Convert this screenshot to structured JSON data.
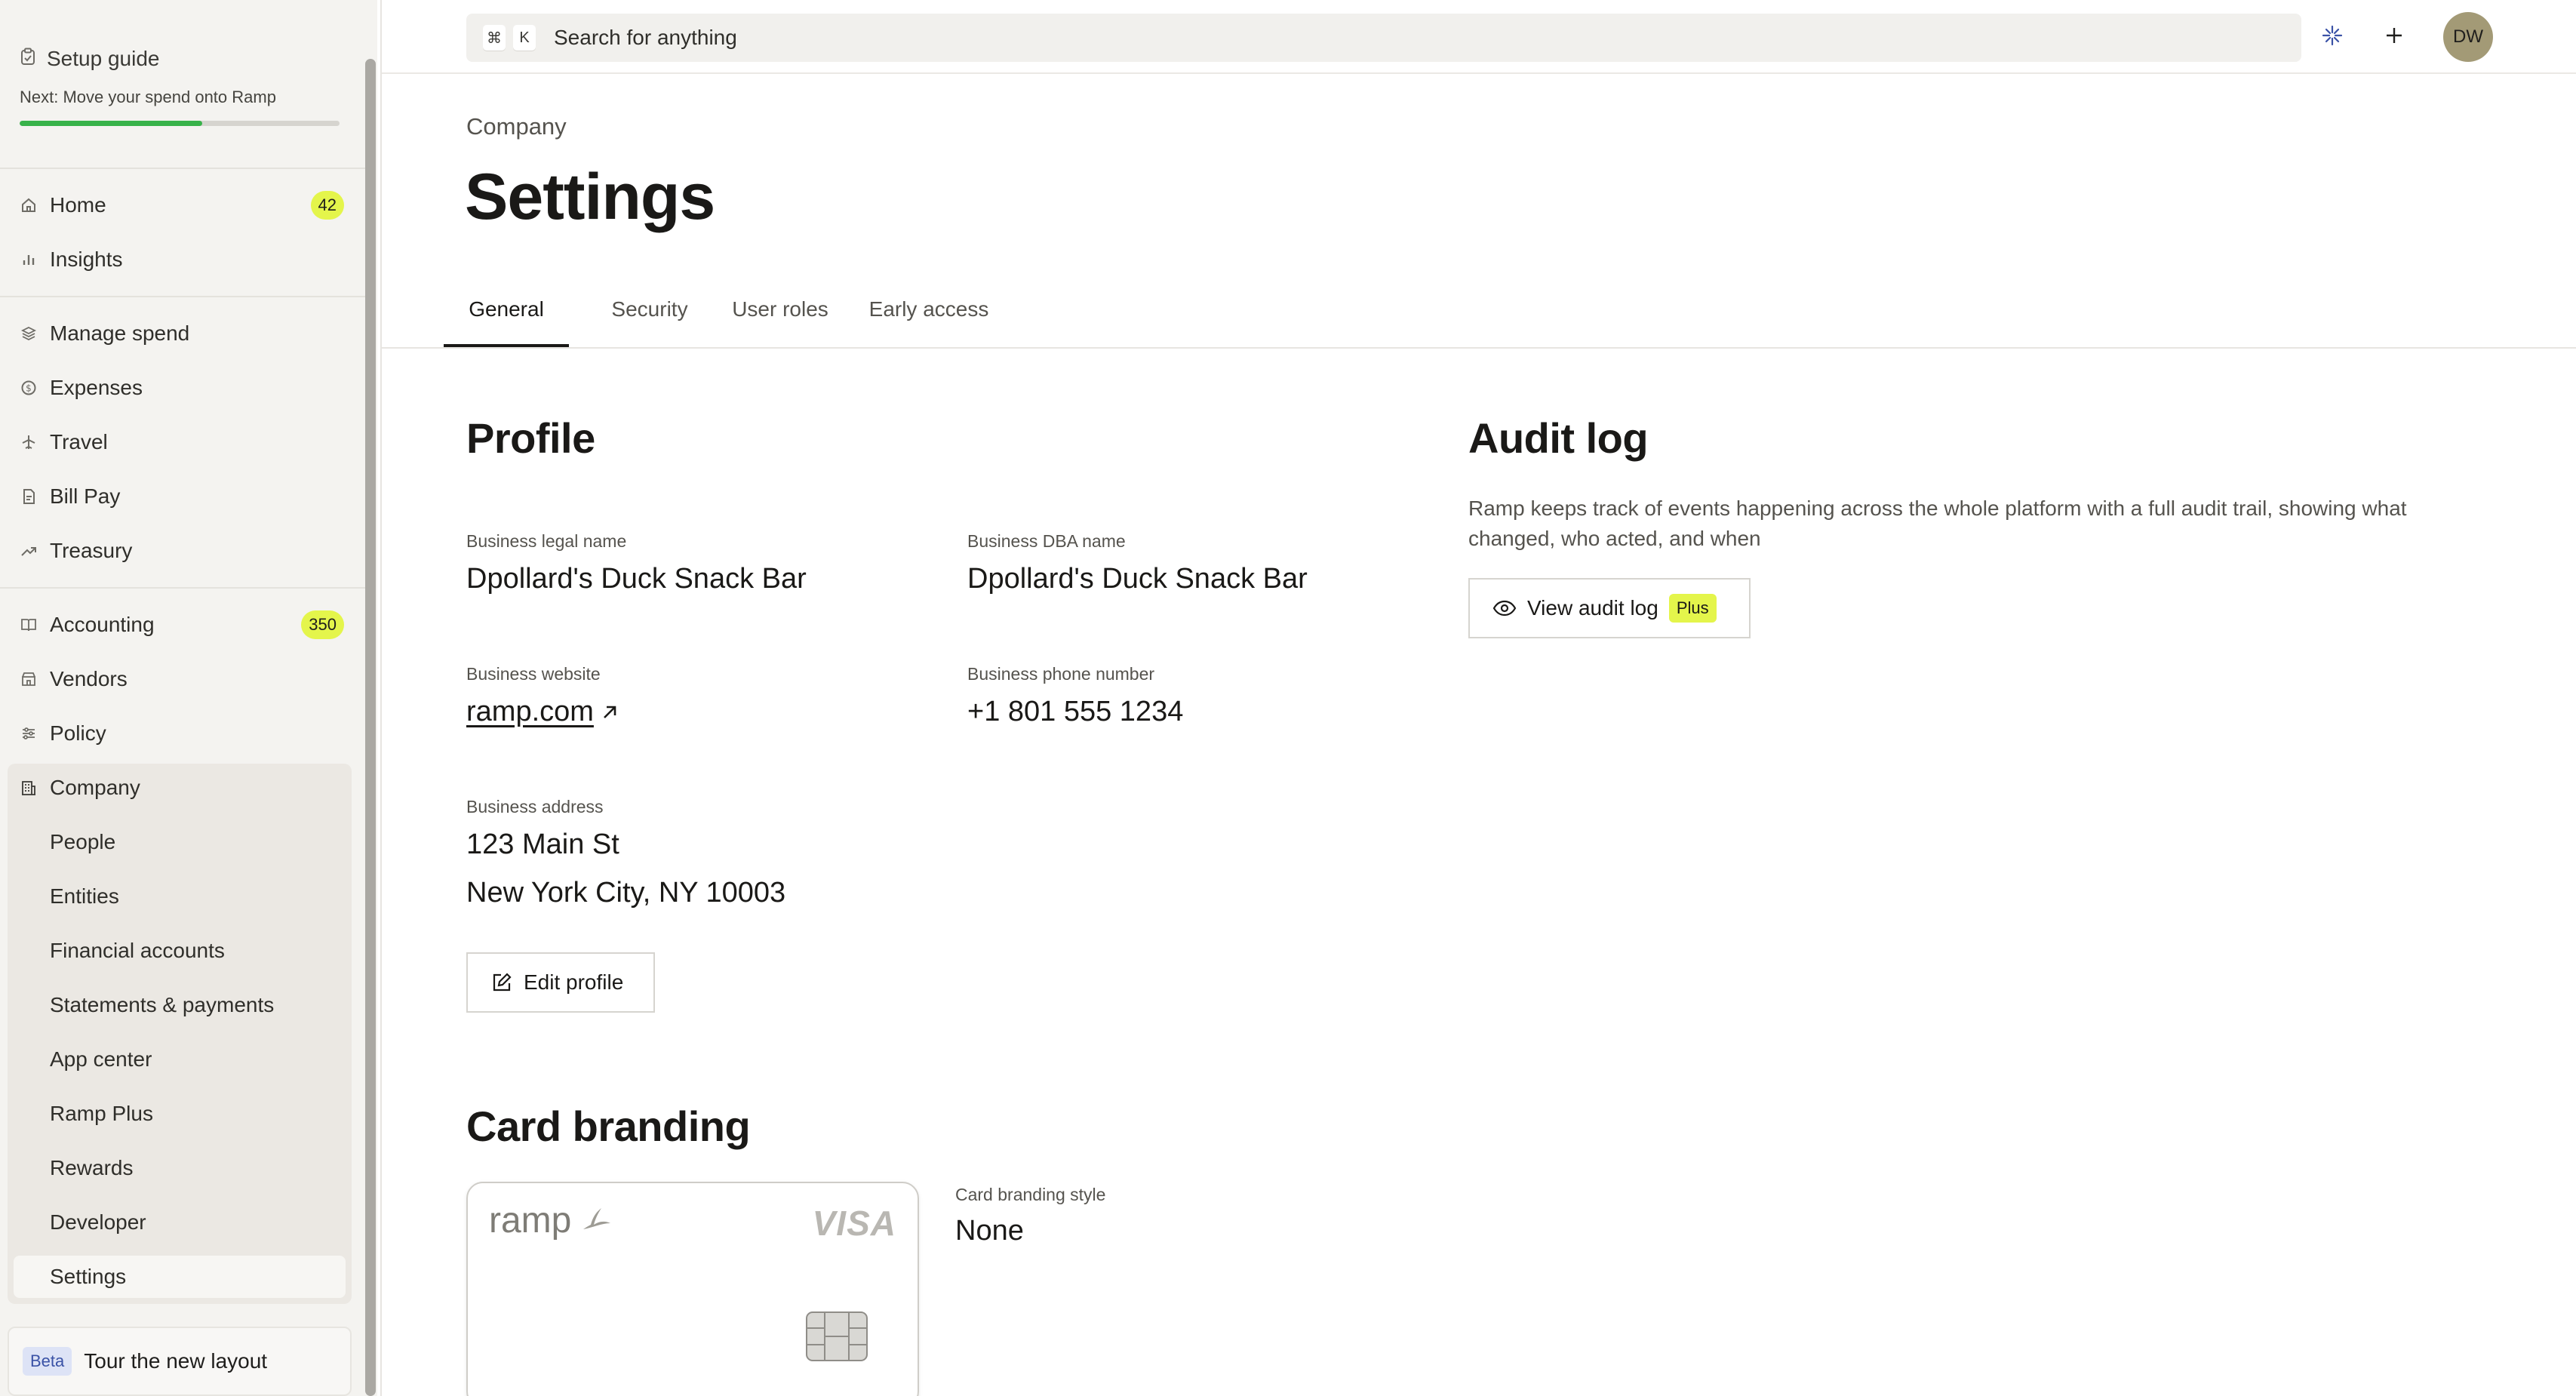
{
  "sidebar": {
    "setup": {
      "title": "Setup guide",
      "next": "Next: Move your spend onto Ramp",
      "progress": 0.57
    },
    "items": [
      {
        "label": "Home",
        "icon": "home-icon",
        "badge": "42"
      },
      {
        "label": "Insights",
        "icon": "bar-chart-icon",
        "badge": ""
      },
      {
        "label": "Manage spend",
        "icon": "layers-icon",
        "badge": ""
      },
      {
        "label": "Expenses",
        "icon": "dollar-circle-icon",
        "badge": ""
      },
      {
        "label": "Travel",
        "icon": "plane-icon",
        "badge": ""
      },
      {
        "label": "Bill Pay",
        "icon": "document-icon",
        "badge": ""
      },
      {
        "label": "Treasury",
        "icon": "trend-up-icon",
        "badge": ""
      },
      {
        "label": "Accounting",
        "icon": "book-icon",
        "badge": "350"
      },
      {
        "label": "Vendors",
        "icon": "store-icon",
        "badge": ""
      },
      {
        "label": "Policy",
        "icon": "sliders-icon",
        "badge": ""
      },
      {
        "label": "Company",
        "icon": "building-icon",
        "badge": ""
      }
    ],
    "company_sub": [
      "People",
      "Entities",
      "Financial accounts",
      "Statements & payments",
      "App center",
      "Ramp Plus",
      "Rewards",
      "Developer",
      "Settings"
    ],
    "tour": {
      "badge": "Beta",
      "label": "Tour the new layout"
    }
  },
  "topbar": {
    "kbd1": "⌘",
    "kbd2": "K",
    "search_placeholder": "Search for anything",
    "avatar": "DW"
  },
  "page": {
    "breadcrumb": "Company",
    "title": "Settings",
    "tabs": [
      "General",
      "Security",
      "User roles",
      "Early access"
    ],
    "active_tab": "General"
  },
  "profile": {
    "heading": "Profile",
    "legal_name_label": "Business legal name",
    "legal_name": "Dpollard's Duck Snack Bar",
    "dba_label": "Business DBA name",
    "dba": "Dpollard's Duck Snack Bar",
    "website_label": "Business website",
    "website": "ramp.com",
    "phone_label": "Business phone number",
    "phone": "+1 801 555 1234",
    "address_label": "Business address",
    "address_line1": "123 Main St",
    "address_line2": "New York City, NY 10003",
    "edit_button": "Edit profile"
  },
  "audit": {
    "heading": "Audit log",
    "description": "Ramp keeps track of events happening across the whole platform with a full audit trail, showing what changed, who acted, and when",
    "button": "View audit log",
    "tag": "Plus"
  },
  "branding": {
    "heading": "Card branding",
    "card_brand": "ramp",
    "card_network": "VISA",
    "style_label": "Card branding style",
    "style_value": "None"
  },
  "colors": {
    "accent_yellow": "#e4f54b",
    "progress_green": "#38b24a",
    "beta_blue": "#dde3f6",
    "avatar_bg": "#a39a76"
  }
}
